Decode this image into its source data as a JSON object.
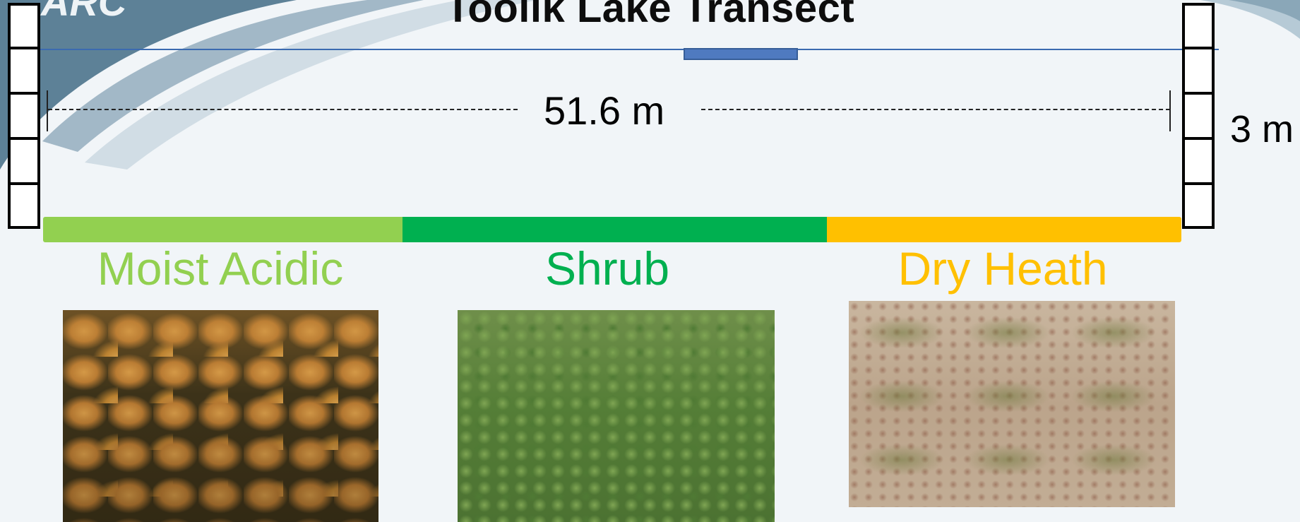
{
  "title": "Toolik Lake Transect",
  "logo_text": "ARC",
  "transect": {
    "length_label": "51.6 m",
    "width_label": "3 m"
  },
  "zones": [
    {
      "label": "Moist Acidic",
      "color": "#92d050"
    },
    {
      "label": "Shrub",
      "color": "#00b050"
    },
    {
      "label": "Dry Heath",
      "color": "#ffc000"
    }
  ],
  "colors": {
    "background": "#f1f5f8",
    "swoosh_dark": "#6f93a8",
    "swoosh_light": "#b9cbd6",
    "top_line": "#3b6ab0",
    "handle": "#4f7ac0"
  }
}
